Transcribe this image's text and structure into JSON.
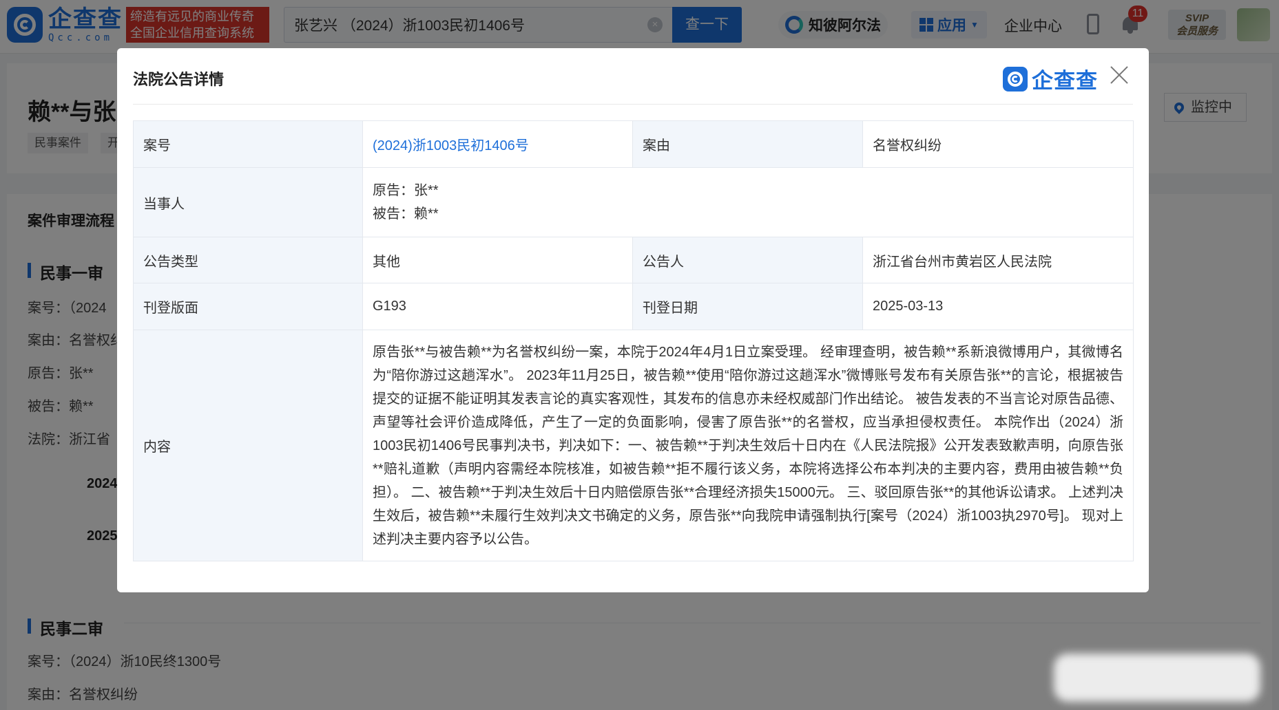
{
  "brand": {
    "name_cn": "企查查",
    "name_en": "Qcc.com",
    "slogan_line1": "缔造有远见的商业传奇",
    "slogan_line2": "全国企业信用查询系统"
  },
  "search": {
    "value": "张艺兴 （2024）浙1003民初1406号",
    "button": "查一下"
  },
  "nav": {
    "zhibi": "知彼阿尔法",
    "app": "应用",
    "enterprise_center": "企业中心",
    "notification_count": "11",
    "svip_line1": "SVIP",
    "svip_line2": "会员服务"
  },
  "background": {
    "title": "赖**与张",
    "tags": [
      "民事案件",
      "开"
    ],
    "monitor": "监控中",
    "section_title": "案件审理流程",
    "first_trial": {
      "heading": "民事一审",
      "case_no": "案号：（2024",
      "cause": "案由：名誉权纠",
      "plaintiff": "原告：张**",
      "defendant": "被告：赖**",
      "court": "法院：浙江省",
      "date1": "2024",
      "date2": "2025"
    },
    "second_trial": {
      "heading": "民事二审",
      "case_no": "案号：（2024）浙10民终1300号",
      "cause": "案由：名誉权纠纷"
    }
  },
  "modal": {
    "title": "法院公告详情",
    "logo_text": "企查查",
    "rows": {
      "case_no_label": "案号",
      "case_no_value": "(2024)浙1003民初1406号",
      "cause_label": "案由",
      "cause_value": "名誉权纠纷",
      "party_label": "当事人",
      "plaintiff": "原告：张**",
      "defendant": "被告：赖**",
      "type_label": "公告类型",
      "type_value": "其他",
      "announcer_label": "公告人",
      "announcer_value": "浙江省台州市黄岩区人民法院",
      "page_label": "刊登版面",
      "page_value": "G193",
      "date_label": "刊登日期",
      "date_value": "2025-03-13",
      "content_label": "内容",
      "content_value": "原告张**与被告赖**为名誉权纠纷一案，本院于2024年4月1日立案受理。 经审理查明，被告赖**系新浪微博用户，其微博名为“陪你游过这趟浑水”。 2023年11月25日，被告赖**使用“陪你游过这趟浑水”微博账号发布有关原告张**的言论，根据被告提交的证据不能证明其发表言论的真实客观性，其发布的信息亦未经权威部门作出结论。 被告发表的不当言论对原告品德、声望等社会评价造成降低，产生了一定的负面影响，侵害了原告张**的名誉权，应当承担侵权责任。 本院作出（2024）浙1003民初1406号民事判决书，判决如下：一、被告赖**于判决生效后十日内在《人民法院报》公开发表致歉声明，向原告张**赔礼道歉（声明内容需经本院核准，如被告赖**拒不履行该义务，本院将选择公布本判决的主要内容，费用由被告赖**负担）。 二、被告赖**于判决生效后十日内赔偿原告张**合理经济损失15000元。 三、驳回原告张**的其他诉讼请求。 上述判决生效后，被告赖**未履行生效判决文书确定的义务，原告张**向我院申请强制执行[案号（2024）浙1003执2970号]。 现对上述判决主要内容予以公告。"
    }
  },
  "colors": {
    "brand_blue": "#1e6fd9",
    "slogan_red": "#d9342b",
    "label_bg": "#f2f6fb"
  }
}
